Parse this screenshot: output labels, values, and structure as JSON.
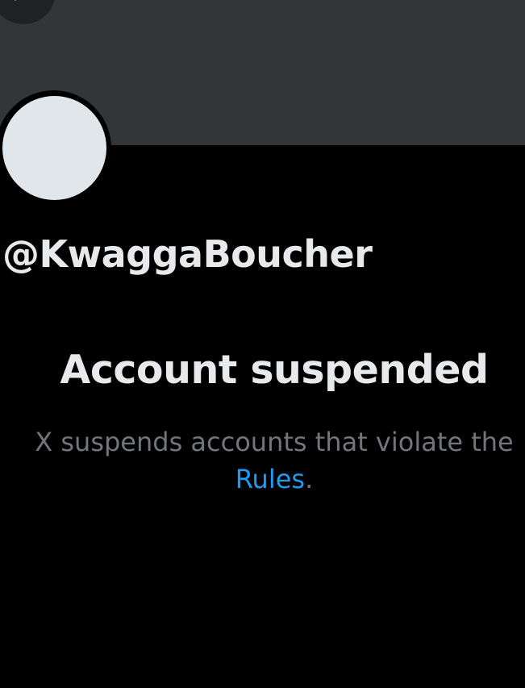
{
  "profile": {
    "handle": "@KwaggaBoucher"
  },
  "suspension": {
    "title": "Account suspended",
    "message_line1": "X suspends accounts that violate the",
    "rules_link": "Rules",
    "period": "."
  },
  "icons": {
    "back": "arrow-left-icon"
  },
  "colors": {
    "background": "#000000",
    "banner": "#333639",
    "avatar": "#e1e6ea",
    "text_primary": "#e7e9ea",
    "text_secondary": "#71767b",
    "link": "#1d9bf0"
  }
}
